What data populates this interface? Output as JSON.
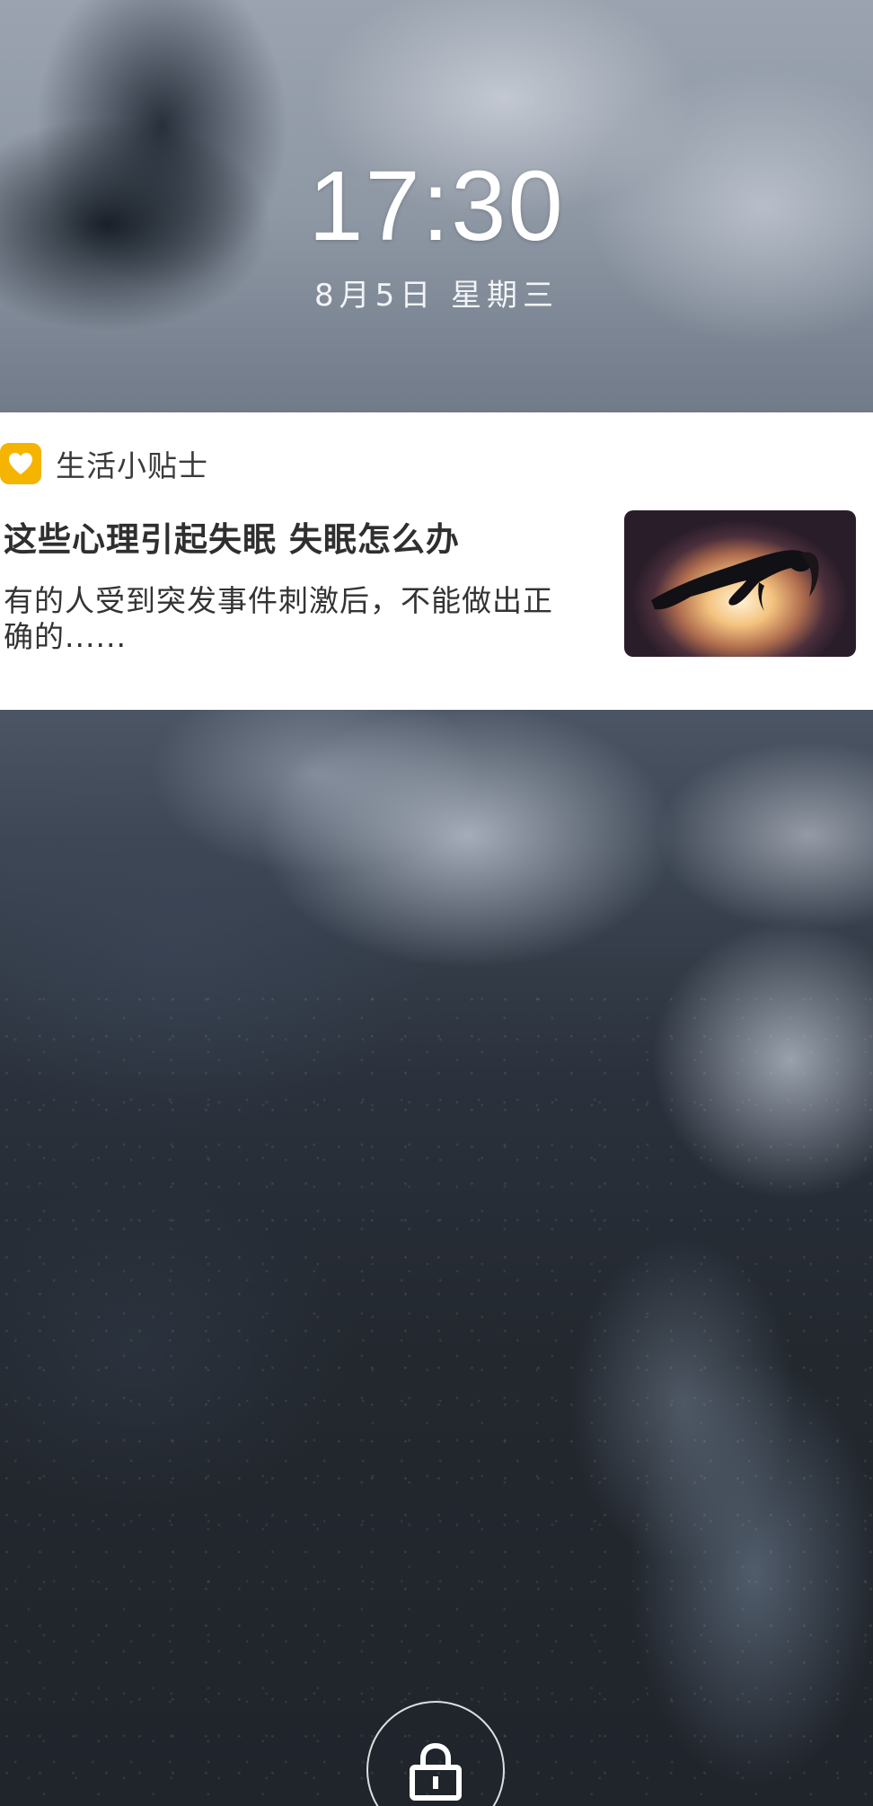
{
  "lockscreen": {
    "time": "17:30",
    "date": "8月5日  星期三"
  },
  "notification": {
    "app_name": "生活小贴士",
    "app_icon": "heart-icon",
    "title": "这些心理引起失眠 失眠怎么办",
    "body": "有的人受到突发事件刺激后，不能做出正确的......",
    "thumbnail": "floating-person-image",
    "accent_color": "#f5b400"
  },
  "unlock": {
    "icon": "lock-icon"
  }
}
